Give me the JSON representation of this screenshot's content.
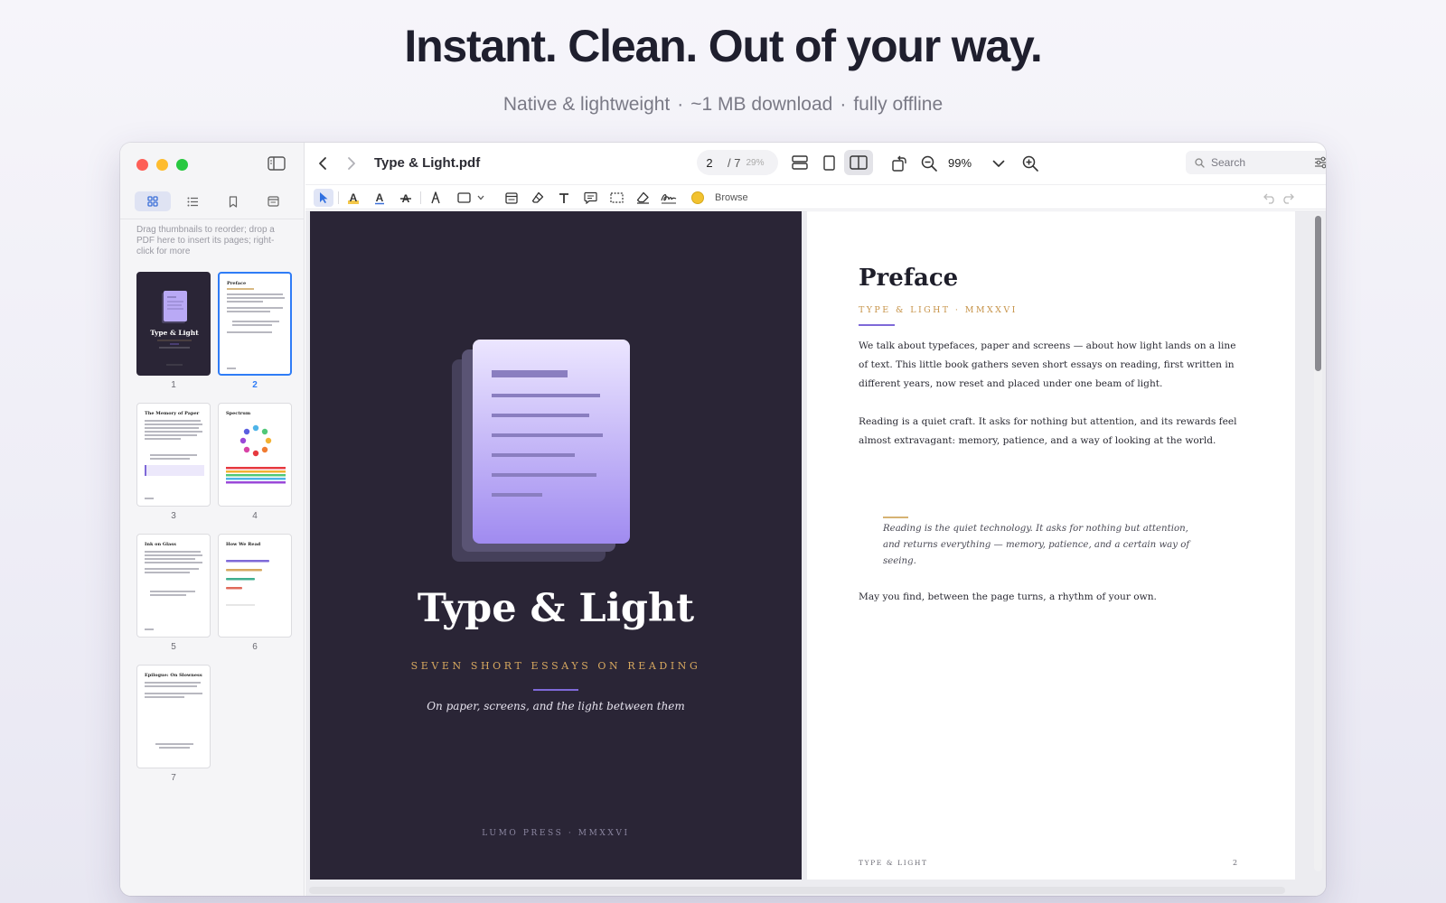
{
  "hero": {
    "headline": "Instant. Clean. Out of your way.",
    "features": [
      "Native & lightweight",
      "~1 MB download",
      "fully offline"
    ],
    "separator": "·"
  },
  "window": {
    "title": "Type & Light.pdf",
    "page": {
      "current": "2",
      "total": "/ 7",
      "percent": "29%"
    },
    "zoom": "99%",
    "search_placeholder": "Search",
    "browse_label": "Browse",
    "accent": "#2f7cf6"
  },
  "sidebar": {
    "hint": "Drag thumbnails to reorder; drop a PDF here to insert its pages; right-click for more",
    "tabs": [
      {
        "icon": "grid-icon",
        "active": true
      },
      {
        "icon": "list-icon",
        "active": false
      },
      {
        "icon": "bookmark-icon",
        "active": false
      },
      {
        "icon": "annotations-icon",
        "active": false
      }
    ],
    "thumbnails": [
      {
        "number": "1",
        "title": "Type & Light",
        "selected": false
      },
      {
        "number": "2",
        "title": "Preface",
        "selected": true
      },
      {
        "number": "3",
        "title": "The Memory of Paper",
        "selected": false
      },
      {
        "number": "4",
        "title": "Spectrum",
        "selected": false
      },
      {
        "number": "5",
        "title": "Ink on Glass",
        "selected": false
      },
      {
        "number": "6",
        "title": "How We Read",
        "selected": false
      },
      {
        "number": "7",
        "title": "Epilogue: On Slowness",
        "selected": false
      }
    ]
  },
  "cover": {
    "title": "Type & Light",
    "subtitle": "SEVEN SHORT ESSAYS ON READING",
    "tagline": "On paper, screens, and the light between them",
    "publisher": "LUMO PRESS · MMXXVI",
    "background": "#2a2536",
    "gold": "#d7a85f",
    "violet": "#7e69d8"
  },
  "preface": {
    "title": "Preface",
    "kicker": "TYPE & LIGHT · MMXXVI",
    "paragraph1": "We talk about typefaces, paper and screens — about how light lands on a line of text. This little book gathers seven short essays on reading, first written in different years, now reset and placed under one beam of light.",
    "paragraph2": "Reading is a quiet craft. It asks for nothing but attention, and its rewards feel almost extravagant: memory, patience, and a way of looking at the world.",
    "quote": "Reading is the quiet technology. It asks for nothing but attention, and returns everything — memory, patience, and a certain way of seeing.",
    "paragraph3": "May you find, between the page turns, a rhythm of your own.",
    "footer_left": "TYPE & LIGHT",
    "footer_right": "2"
  }
}
